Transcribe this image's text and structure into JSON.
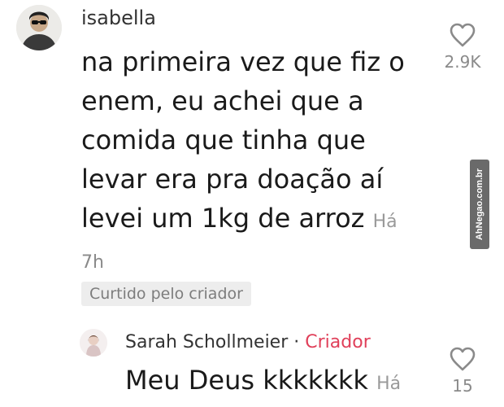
{
  "comment": {
    "username": "isabella",
    "text": "na primeira vez que fiz o enem, eu achei que a comida que tinha que levar era pra doação aí levei um 1kg de arroz",
    "time_prefix": "Há",
    "time_suffix": "7h",
    "liked_by_creator": "Curtido pelo criador",
    "like_count": "2.9K"
  },
  "reply": {
    "username": "Sarah Schollmeier",
    "separator": "·",
    "badge": "Criador",
    "text": "Meu Deus kkkkkkk",
    "time_prefix": "Há",
    "like_count": "15"
  },
  "watermark": {
    "text": "AhNegao.com.br"
  },
  "colors": {
    "creator_badge": "#e0405a",
    "muted": "#8a8a8a",
    "badge_bg": "#ededed"
  },
  "icons": {
    "like": "heart-outline-icon"
  }
}
